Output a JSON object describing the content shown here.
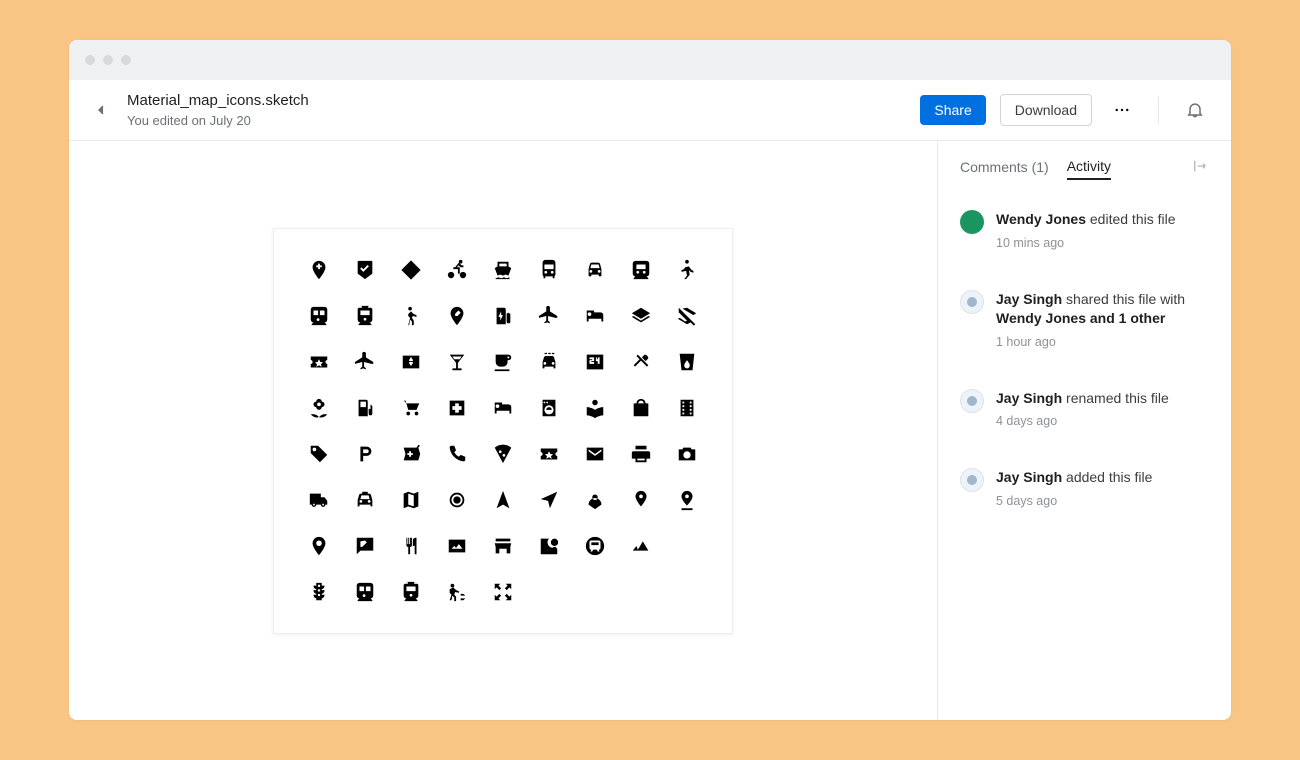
{
  "header": {
    "file_name": "Material_map_icons.sketch",
    "sub_line": "You edited on July 20",
    "share_label": "Share",
    "download_label": "Download"
  },
  "sidebar": {
    "tab_comments": "Comments (1)",
    "tab_activity": "Activity",
    "active_tab": "activity",
    "items": [
      {
        "actor": "Wendy Jones",
        "action": " edited this file",
        "extra": "",
        "time": "10 mins ago",
        "avatar": "green"
      },
      {
        "actor": "Jay Singh",
        "action": " shared this file with ",
        "extra": "Wendy Jones and 1 other",
        "time": "1 hour ago",
        "avatar": "blue"
      },
      {
        "actor": "Jay Singh",
        "action": " renamed this file",
        "extra": "",
        "time": "4 days ago",
        "avatar": "blue"
      },
      {
        "actor": "Jay Singh",
        "action": " added this file",
        "extra": "",
        "time": "5 days ago",
        "avatar": "blue"
      }
    ]
  },
  "artboard": {
    "icons": [
      "add_location",
      "beenhere",
      "directions",
      "directions_bike",
      "directions_ferry",
      "directions_bus",
      "directions_car",
      "directions_subway",
      "directions_run",
      "directions_train",
      "tram",
      "directions_walk",
      "edit_location",
      "ev_station",
      "flight",
      "hotel",
      "layers",
      "layers_clear",
      "local_activity",
      "local_airport",
      "local_atm",
      "local_bar",
      "local_cafe",
      "local_car_wash",
      "local_convenience_store",
      "restaurant",
      "local_drink",
      "local_florist",
      "local_gas_station",
      "local_grocery_store",
      "local_hospital",
      "local_hotel",
      "local_laundry_service",
      "local_library",
      "local_mall",
      "local_movies",
      "local_offer",
      "local_parking",
      "local_pharmacy",
      "local_phone",
      "local_pizza",
      "local_play",
      "local_post_office",
      "local_print_shop",
      "local_see",
      "local_shipping",
      "local_taxi",
      "map",
      "my_location",
      "navigation",
      "near_me",
      "person_pin",
      "pin_location",
      "pin_drop",
      "place",
      "rate_review",
      "restaurant_menu",
      "satellite",
      "store_mall_directory",
      "streetview",
      "subway_circle",
      "terrain",
      "",
      "traffic",
      "train",
      "tram2",
      "transfer_within_a_station",
      "zoom_out_map",
      "",
      "",
      "",
      ""
    ]
  }
}
